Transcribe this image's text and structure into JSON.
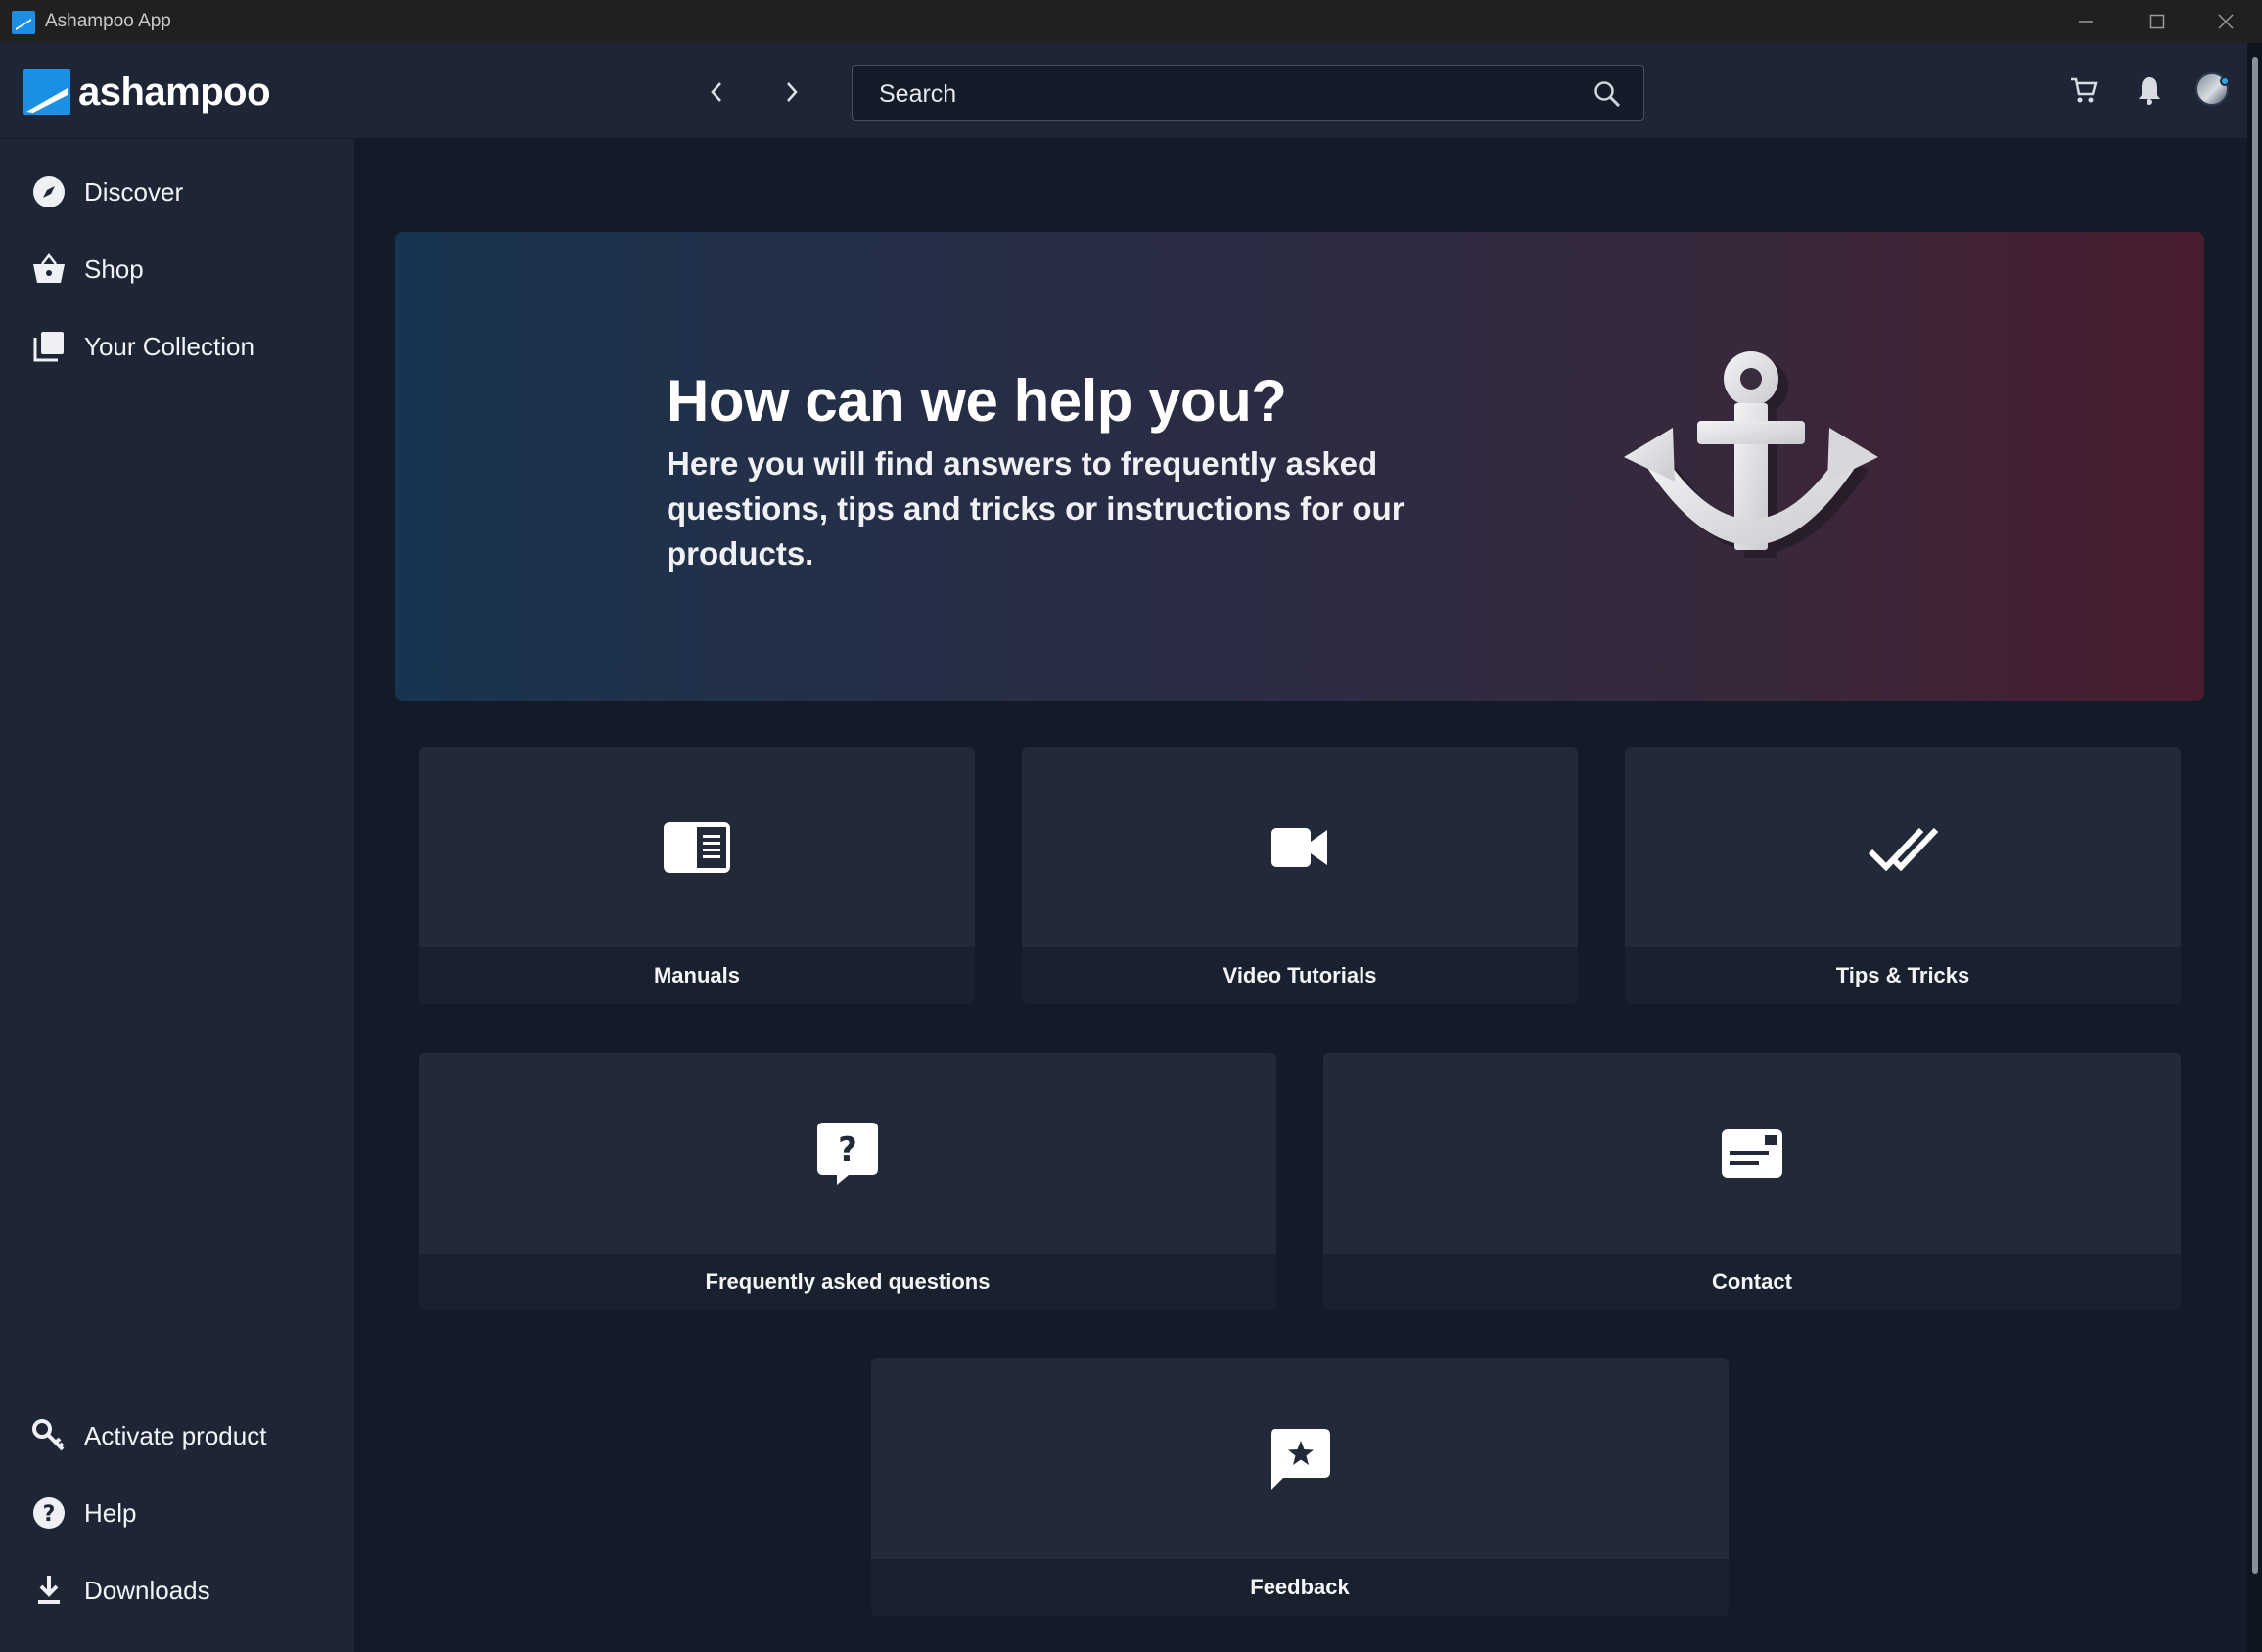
{
  "window": {
    "title": "Ashampoo App"
  },
  "header": {
    "logo_text": "ashampoo",
    "search_placeholder": "Search"
  },
  "sidebar": {
    "top_items": [
      {
        "label": "Discover",
        "icon": "compass-icon"
      },
      {
        "label": "Shop",
        "icon": "basket-icon"
      },
      {
        "label": "Your Collection",
        "icon": "collection-icon"
      }
    ],
    "bottom_items": [
      {
        "label": "Activate product",
        "icon": "key-icon"
      },
      {
        "label": "Help",
        "icon": "help-icon"
      },
      {
        "label": "Downloads",
        "icon": "download-icon"
      }
    ]
  },
  "hero": {
    "title": "How can we help you?",
    "subtitle": "Here you will find answers to frequently asked questions, tips and tricks or instructions for our products."
  },
  "cards": [
    {
      "label": "Manuals",
      "icon": "manual-icon"
    },
    {
      "label": "Video Tutorials",
      "icon": "video-icon"
    },
    {
      "label": "Tips & Tricks",
      "icon": "double-check-icon"
    },
    {
      "label": "Frequently asked questions",
      "icon": "question-bubble-icon"
    },
    {
      "label": "Contact",
      "icon": "contact-card-icon"
    },
    {
      "label": "Feedback",
      "icon": "star-bubble-icon"
    }
  ],
  "colors": {
    "accent": "#1a8fe3",
    "sidebar_bg": "#1e2636",
    "content_bg": "#131a28",
    "card_bg": "#222a39"
  }
}
